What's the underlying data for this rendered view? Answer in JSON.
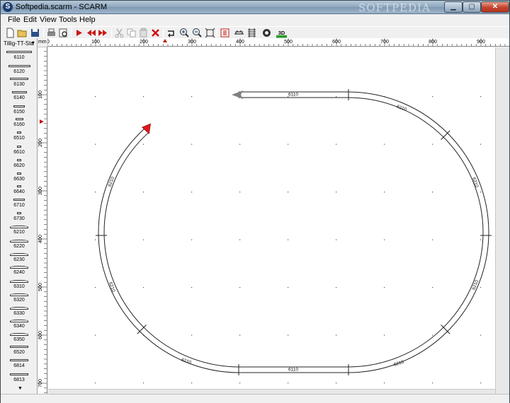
{
  "window": {
    "title": "Softpedia.scarm - SCARM",
    "watermark": "SOFTPEDIA",
    "app_icon": "S"
  },
  "menu": [
    "File",
    "Edit",
    "View",
    "Tools",
    "Help"
  ],
  "toolbar": {
    "icons": [
      "new-file-icon",
      "open-folder-icon",
      "save-icon",
      "print-icon",
      "print-preview-icon",
      "play-arrow-icon",
      "prev-arrows-icon",
      "next-arrows-icon",
      "cut-icon",
      "copy-icon",
      "paste-icon",
      "delete-icon",
      "rotate-icon",
      "zoom-in-icon",
      "zoom-out-icon",
      "fit-view-icon",
      "layers-icon",
      "bridge-icon",
      "rail-icon",
      "ring-icon",
      "3d-view-icon"
    ],
    "view3d_label": "3D"
  },
  "palette": {
    "library": "Tillig-TT-Std",
    "items": [
      "6110",
      "6120",
      "6130",
      "6140",
      "6150",
      "6160",
      "6510",
      "6610",
      "6620",
      "6630",
      "6640",
      "6710",
      "6730",
      "6210",
      "6220",
      "6230",
      "6240",
      "6310",
      "6320",
      "6330",
      "6340",
      "6350",
      "6520",
      "6814",
      "6813"
    ]
  },
  "ruler": {
    "unit": "mm",
    "x_labels": [
      "0",
      "100",
      "200",
      "300",
      "400",
      "500",
      "600",
      "700",
      "800",
      "900"
    ],
    "y_labels": [
      "100",
      "200",
      "300",
      "400",
      "500",
      "600",
      "700"
    ]
  },
  "layout": {
    "tracks": [
      {
        "type": "straight",
        "label": "6110",
        "position": "top-straight"
      },
      {
        "type": "curve",
        "label": "6210",
        "position": "top-right-curve"
      },
      {
        "type": "curve",
        "label": "6210",
        "position": "right-upper-curve"
      },
      {
        "type": "curve",
        "label": "6210",
        "position": "right-lower-curve"
      },
      {
        "type": "curve",
        "label": "6210",
        "position": "bottom-right-curve"
      },
      {
        "type": "straight",
        "label": "6110",
        "position": "bottom-straight"
      },
      {
        "type": "curve",
        "label": "6210",
        "position": "bottom-left-curve"
      },
      {
        "type": "curve",
        "label": "6210",
        "position": "left-lower-curve"
      },
      {
        "type": "curve",
        "label": "6210",
        "position": "left-upper-curve"
      }
    ],
    "end_marker_color": "#e0161a",
    "start_marker_color": "#808080"
  }
}
